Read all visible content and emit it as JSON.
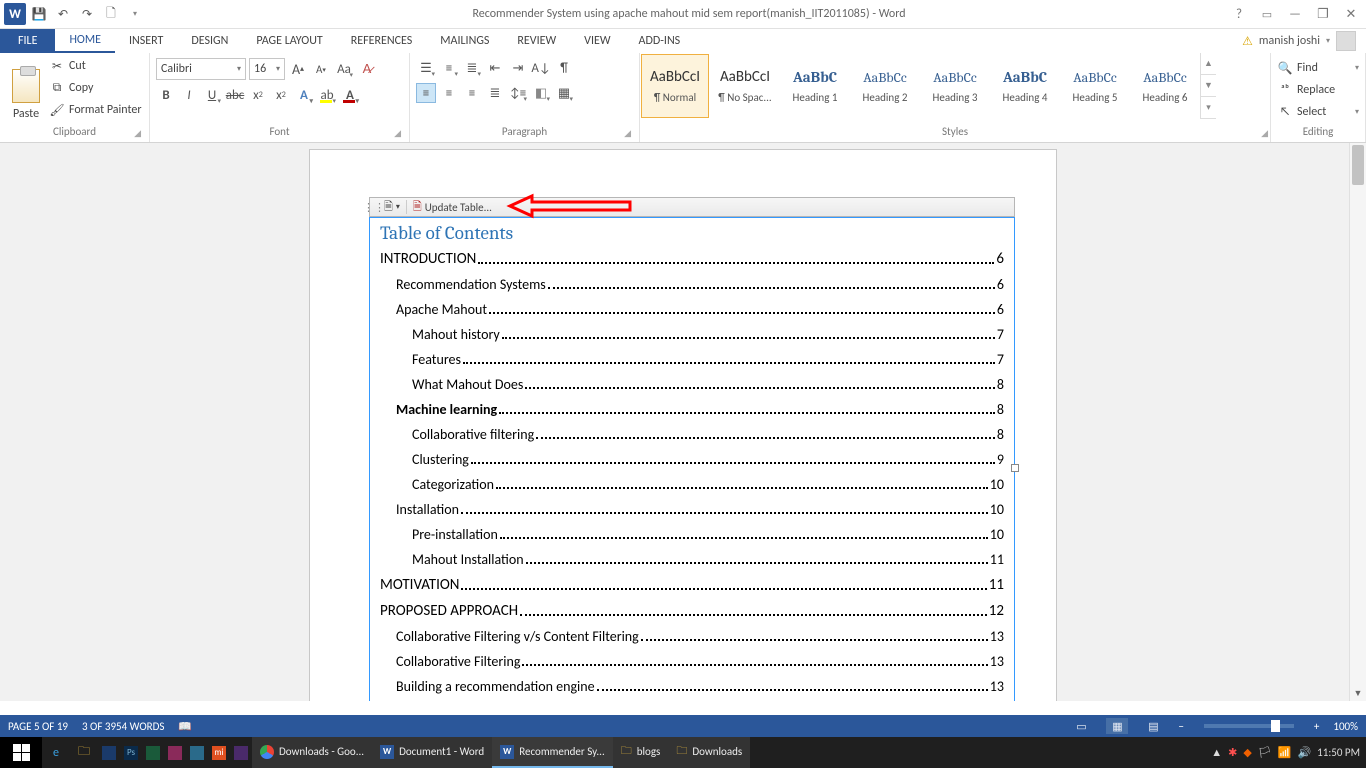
{
  "titlebar": {
    "title": "Recommender System using apache mahout mid sem report(manish_IIT2011085) - Word"
  },
  "tabs": {
    "file": "FILE",
    "items": [
      "HOME",
      "INSERT",
      "DESIGN",
      "PAGE LAYOUT",
      "REFERENCES",
      "MAILINGS",
      "REVIEW",
      "VIEW",
      "ADD-INS"
    ],
    "active": "HOME"
  },
  "account": {
    "name": "manish joshi"
  },
  "ribbon": {
    "clipboard": {
      "label": "Clipboard",
      "paste": "Paste",
      "cut": "Cut",
      "copy": "Copy",
      "fmt": "Format Painter"
    },
    "font": {
      "label": "Font",
      "name": "Calibri",
      "size": "16"
    },
    "paragraph": {
      "label": "Paragraph"
    },
    "styles": {
      "label": "Styles",
      "items": [
        {
          "preview": "AaBbCcI",
          "name": "¶ Normal",
          "active": true,
          "cls": ""
        },
        {
          "preview": "AaBbCcI",
          "name": "¶ No Spac...",
          "cls": ""
        },
        {
          "preview": "AaBbC",
          "name": "Heading 1",
          "cls": "h1"
        },
        {
          "preview": "AaBbCc",
          "name": "Heading 2",
          "cls": "h"
        },
        {
          "preview": "AaBbCc",
          "name": "Heading 3",
          "cls": "h"
        },
        {
          "preview": "AaBbC",
          "name": "Heading 4",
          "cls": "h3p"
        },
        {
          "preview": "AaBbCc",
          "name": "Heading 5",
          "cls": "h"
        },
        {
          "preview": "AaBbCc",
          "name": "Heading 6",
          "cls": "h"
        }
      ]
    },
    "editing": {
      "label": "Editing",
      "find": "Find",
      "replace": "Replace",
      "select": "Select"
    }
  },
  "toc": {
    "update": "Update Table...",
    "title": "Table of Contents",
    "entries": [
      {
        "level": 1,
        "text": "INTRODUCTION",
        "page": "6",
        "caps": true
      },
      {
        "level": 2,
        "text": "Recommendation Systems",
        "page": "6"
      },
      {
        "level": 2,
        "text": "Apache Mahout",
        "page": "6"
      },
      {
        "level": 3,
        "text": "Mahout history",
        "page": "7"
      },
      {
        "level": 3,
        "text": "Features",
        "page": "7"
      },
      {
        "level": 3,
        "text": "What Mahout Does",
        "page": "8"
      },
      {
        "level": 2,
        "text": "Machine learning",
        "page": "8",
        "bold": true
      },
      {
        "level": 3,
        "text": "Collaborative filtering",
        "page": "8"
      },
      {
        "level": 3,
        "text": "Clustering",
        "page": "9"
      },
      {
        "level": 3,
        "text": "Categorization",
        "page": "10"
      },
      {
        "level": 2,
        "text": "Installation",
        "page": "10"
      },
      {
        "level": 3,
        "text": "Pre-installation",
        "page": "10"
      },
      {
        "level": 3,
        "text": "Mahout Installation",
        "page": "11"
      },
      {
        "level": 1,
        "text": "MOTIVATION",
        "page": "11",
        "caps": true
      },
      {
        "level": 1,
        "text": "PROPOSED APPROACH",
        "page": "12",
        "caps": true
      },
      {
        "level": 2,
        "text": "Collaborative Filtering v/s Content Filtering",
        "page": "13"
      },
      {
        "level": 2,
        "text": "Collaborative Filtering",
        "page": "13"
      },
      {
        "level": 2,
        "text": "Building a recommendation engine",
        "page": "13"
      }
    ]
  },
  "status": {
    "page": "PAGE 5 OF 19",
    "words": "3 OF 3954 WORDS",
    "zoom": "100%"
  },
  "taskbar": {
    "tasks": [
      {
        "label": "Downloads - Goo...",
        "icon": "chrome",
        "active": false
      },
      {
        "label": "Document1 - Word",
        "icon": "word",
        "active": false
      },
      {
        "label": "Recommender Sy...",
        "icon": "word",
        "active": true
      },
      {
        "label": "blogs",
        "icon": "folder",
        "active": false
      },
      {
        "label": "Downloads",
        "icon": "folder",
        "active": false
      }
    ],
    "time": "11:50 PM"
  }
}
